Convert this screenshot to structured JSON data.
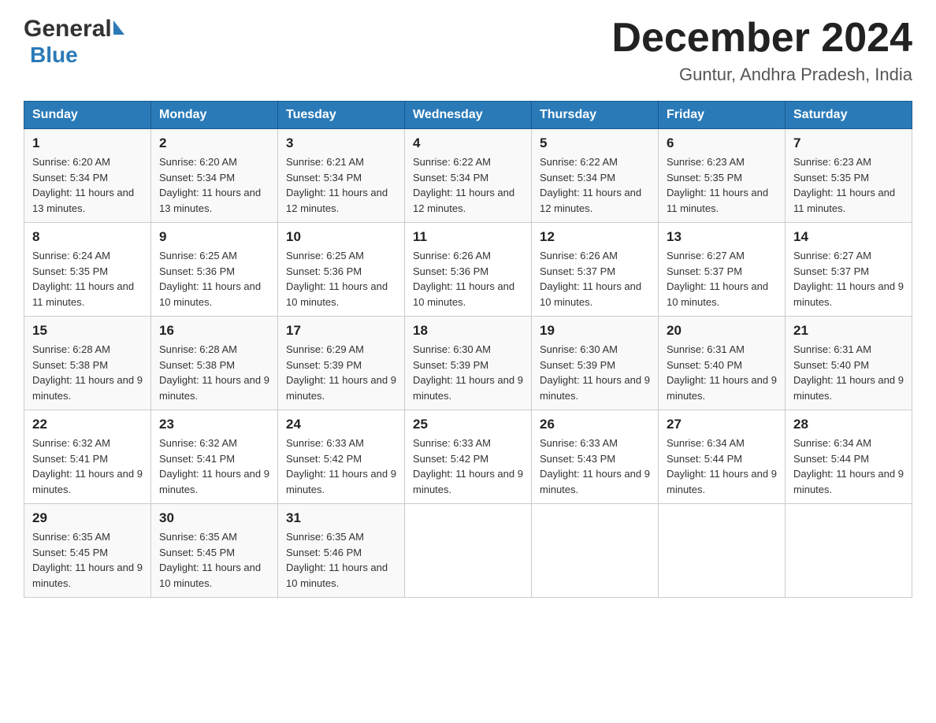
{
  "logo": {
    "general": "General",
    "arrow": "▶",
    "blue": "Blue"
  },
  "title": "December 2024",
  "subtitle": "Guntur, Andhra Pradesh, India",
  "calendar": {
    "headers": [
      "Sunday",
      "Monday",
      "Tuesday",
      "Wednesday",
      "Thursday",
      "Friday",
      "Saturday"
    ],
    "weeks": [
      [
        {
          "day": "1",
          "sunrise": "6:20 AM",
          "sunset": "5:34 PM",
          "daylight": "11 hours and 13 minutes."
        },
        {
          "day": "2",
          "sunrise": "6:20 AM",
          "sunset": "5:34 PM",
          "daylight": "11 hours and 13 minutes."
        },
        {
          "day": "3",
          "sunrise": "6:21 AM",
          "sunset": "5:34 PM",
          "daylight": "11 hours and 12 minutes."
        },
        {
          "day": "4",
          "sunrise": "6:22 AM",
          "sunset": "5:34 PM",
          "daylight": "11 hours and 12 minutes."
        },
        {
          "day": "5",
          "sunrise": "6:22 AM",
          "sunset": "5:34 PM",
          "daylight": "11 hours and 12 minutes."
        },
        {
          "day": "6",
          "sunrise": "6:23 AM",
          "sunset": "5:35 PM",
          "daylight": "11 hours and 11 minutes."
        },
        {
          "day": "7",
          "sunrise": "6:23 AM",
          "sunset": "5:35 PM",
          "daylight": "11 hours and 11 minutes."
        }
      ],
      [
        {
          "day": "8",
          "sunrise": "6:24 AM",
          "sunset": "5:35 PM",
          "daylight": "11 hours and 11 minutes."
        },
        {
          "day": "9",
          "sunrise": "6:25 AM",
          "sunset": "5:36 PM",
          "daylight": "11 hours and 10 minutes."
        },
        {
          "day": "10",
          "sunrise": "6:25 AM",
          "sunset": "5:36 PM",
          "daylight": "11 hours and 10 minutes."
        },
        {
          "day": "11",
          "sunrise": "6:26 AM",
          "sunset": "5:36 PM",
          "daylight": "11 hours and 10 minutes."
        },
        {
          "day": "12",
          "sunrise": "6:26 AM",
          "sunset": "5:37 PM",
          "daylight": "11 hours and 10 minutes."
        },
        {
          "day": "13",
          "sunrise": "6:27 AM",
          "sunset": "5:37 PM",
          "daylight": "11 hours and 10 minutes."
        },
        {
          "day": "14",
          "sunrise": "6:27 AM",
          "sunset": "5:37 PM",
          "daylight": "11 hours and 9 minutes."
        }
      ],
      [
        {
          "day": "15",
          "sunrise": "6:28 AM",
          "sunset": "5:38 PM",
          "daylight": "11 hours and 9 minutes."
        },
        {
          "day": "16",
          "sunrise": "6:28 AM",
          "sunset": "5:38 PM",
          "daylight": "11 hours and 9 minutes."
        },
        {
          "day": "17",
          "sunrise": "6:29 AM",
          "sunset": "5:39 PM",
          "daylight": "11 hours and 9 minutes."
        },
        {
          "day": "18",
          "sunrise": "6:30 AM",
          "sunset": "5:39 PM",
          "daylight": "11 hours and 9 minutes."
        },
        {
          "day": "19",
          "sunrise": "6:30 AM",
          "sunset": "5:39 PM",
          "daylight": "11 hours and 9 minutes."
        },
        {
          "day": "20",
          "sunrise": "6:31 AM",
          "sunset": "5:40 PM",
          "daylight": "11 hours and 9 minutes."
        },
        {
          "day": "21",
          "sunrise": "6:31 AM",
          "sunset": "5:40 PM",
          "daylight": "11 hours and 9 minutes."
        }
      ],
      [
        {
          "day": "22",
          "sunrise": "6:32 AM",
          "sunset": "5:41 PM",
          "daylight": "11 hours and 9 minutes."
        },
        {
          "day": "23",
          "sunrise": "6:32 AM",
          "sunset": "5:41 PM",
          "daylight": "11 hours and 9 minutes."
        },
        {
          "day": "24",
          "sunrise": "6:33 AM",
          "sunset": "5:42 PM",
          "daylight": "11 hours and 9 minutes."
        },
        {
          "day": "25",
          "sunrise": "6:33 AM",
          "sunset": "5:42 PM",
          "daylight": "11 hours and 9 minutes."
        },
        {
          "day": "26",
          "sunrise": "6:33 AM",
          "sunset": "5:43 PM",
          "daylight": "11 hours and 9 minutes."
        },
        {
          "day": "27",
          "sunrise": "6:34 AM",
          "sunset": "5:44 PM",
          "daylight": "11 hours and 9 minutes."
        },
        {
          "day": "28",
          "sunrise": "6:34 AM",
          "sunset": "5:44 PM",
          "daylight": "11 hours and 9 minutes."
        }
      ],
      [
        {
          "day": "29",
          "sunrise": "6:35 AM",
          "sunset": "5:45 PM",
          "daylight": "11 hours and 9 minutes."
        },
        {
          "day": "30",
          "sunrise": "6:35 AM",
          "sunset": "5:45 PM",
          "daylight": "11 hours and 10 minutes."
        },
        {
          "day": "31",
          "sunrise": "6:35 AM",
          "sunset": "5:46 PM",
          "daylight": "11 hours and 10 minutes."
        },
        null,
        null,
        null,
        null
      ]
    ]
  }
}
